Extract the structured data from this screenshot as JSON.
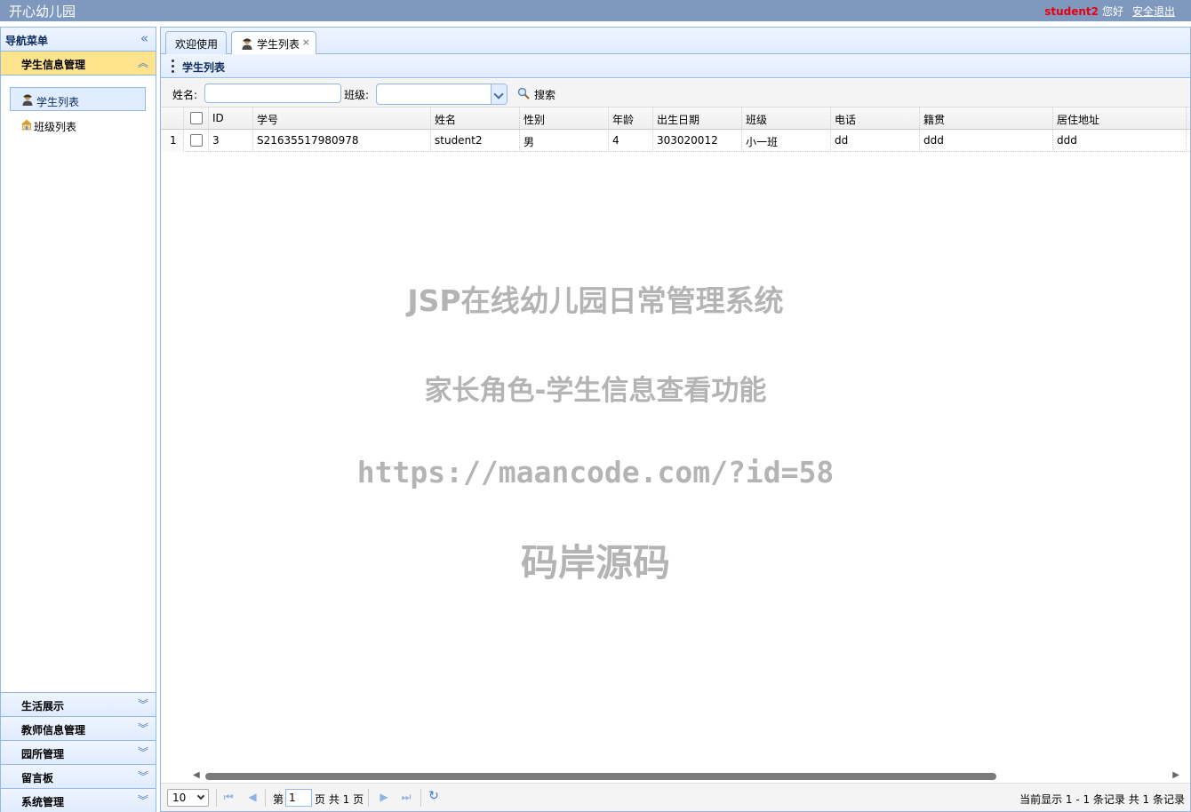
{
  "header": {
    "app_title": "开心幼儿园",
    "user_name": "student2",
    "greeting": "您好",
    "logout": "安全退出"
  },
  "sidebar": {
    "title": "导航菜单",
    "active_section": "学生信息管理",
    "items": [
      {
        "label": "学生列表",
        "icon": "student-icon",
        "selected": true
      },
      {
        "label": "班级列表",
        "icon": "house-icon",
        "selected": false
      }
    ],
    "sections": [
      "生活展示",
      "教师信息管理",
      "园所管理",
      "留言板",
      "系统管理"
    ]
  },
  "tabs": [
    {
      "label": "欢迎使用",
      "active": false
    },
    {
      "label": "学生列表",
      "active": true,
      "closable": true
    }
  ],
  "panel": {
    "title": "学生列表"
  },
  "toolbar": {
    "name_label": "姓名:",
    "name_value": "",
    "class_label": "班级:",
    "class_value": "",
    "search_label": "搜索"
  },
  "grid": {
    "columns": [
      "ID",
      "学号",
      "姓名",
      "性别",
      "年龄",
      "出生日期",
      "班级",
      "电话",
      "籍贯",
      "居住地址"
    ],
    "rows": [
      {
        "rownum": "1",
        "cells": [
          "3",
          "S21635517980978",
          "student2",
          "男",
          "4",
          "303020012",
          "小一班",
          "dd",
          "ddd",
          "ddd"
        ]
      }
    ]
  },
  "watermark": {
    "line1": "JSP在线幼儿园日常管理系统",
    "line2": "家长角色-学生信息查看功能",
    "line3": "https://maancode.com/?id=58",
    "line4": "码岸源码"
  },
  "pager": {
    "page_size": "10",
    "page_prefix": "第",
    "page_number": "1",
    "page_suffix": "页 共 1 页",
    "info": "当前显示 1 - 1 条记录 共 1 条记录"
  },
  "colors": {
    "header_bg": "#7f99be",
    "border": "#95b8e7",
    "active_section": "#ffe48d",
    "user_name": "#e60012"
  }
}
